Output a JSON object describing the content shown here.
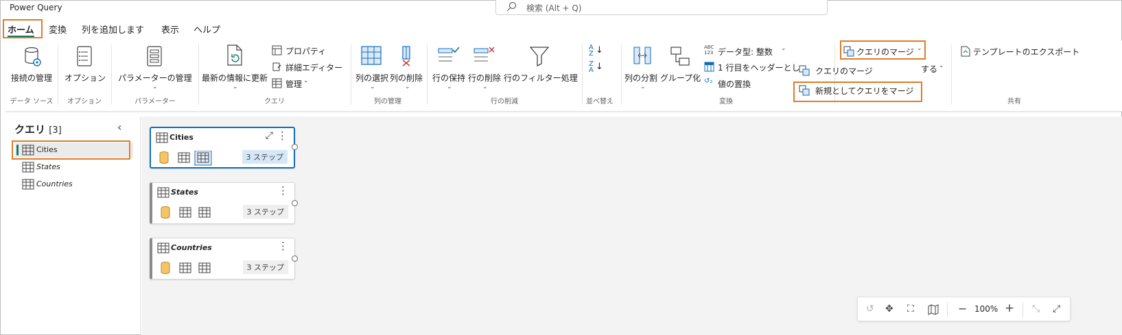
{
  "app_title": "Power Query",
  "search": {
    "placeholder": "検索 (Alt + Q)"
  },
  "tabs": [
    {
      "label": "ホーム",
      "active": true
    },
    {
      "label": "変換"
    },
    {
      "label": "列を追加します"
    },
    {
      "label": "表示"
    },
    {
      "label": "ヘルプ"
    }
  ],
  "ribbon": {
    "groups": {
      "data_source": "データ ソース",
      "options": "オプション",
      "parameters": "パラメーター",
      "query": "クエリ",
      "manage_columns": "列の管理",
      "reduce_rows": "行の削減",
      "sort": "並べ替え",
      "transform": "変換",
      "share": "共有"
    },
    "buttons": {
      "manage_connections": "接続の管理",
      "options": "オプション",
      "manage_parameters": "パラメーターの管理",
      "refresh": "最新の情報に更新",
      "properties": "プロパティ",
      "advanced_editor": "詳細エディター",
      "manage": "管理",
      "choose_columns": "列の選択",
      "remove_columns": "列の削除",
      "keep_rows": "行の保持",
      "remove_rows": "行の削除",
      "filter_rows": "行のフィルター処理",
      "split_column": "列の分割",
      "group_by": "グループ化",
      "data_type": "データ型: 整数",
      "first_row_headers": "1 行目をヘッダーとし",
      "replace_values": "値の置換",
      "merge_queries": "クエリのマージ",
      "merge_item": "クエリのマージ",
      "merge_as_new": "新規としてクエリをマージ",
      "append_suffix": "する",
      "export_template": "テンプレートのエクスポート"
    }
  },
  "queries_panel": {
    "title": "クエリ",
    "count": "[3]",
    "items": [
      "Cities",
      "States",
      "Countries"
    ]
  },
  "cards": [
    {
      "title": "Cities",
      "steps": "3 ステップ"
    },
    {
      "title": "States",
      "steps": "3 ステップ"
    },
    {
      "title": "Countries",
      "steps": "3 ステップ"
    }
  ],
  "zoom": {
    "value": "100%"
  },
  "colors": {
    "accent": "#117865",
    "highlight": "#e07b24",
    "selected": "#0f6cbd"
  }
}
